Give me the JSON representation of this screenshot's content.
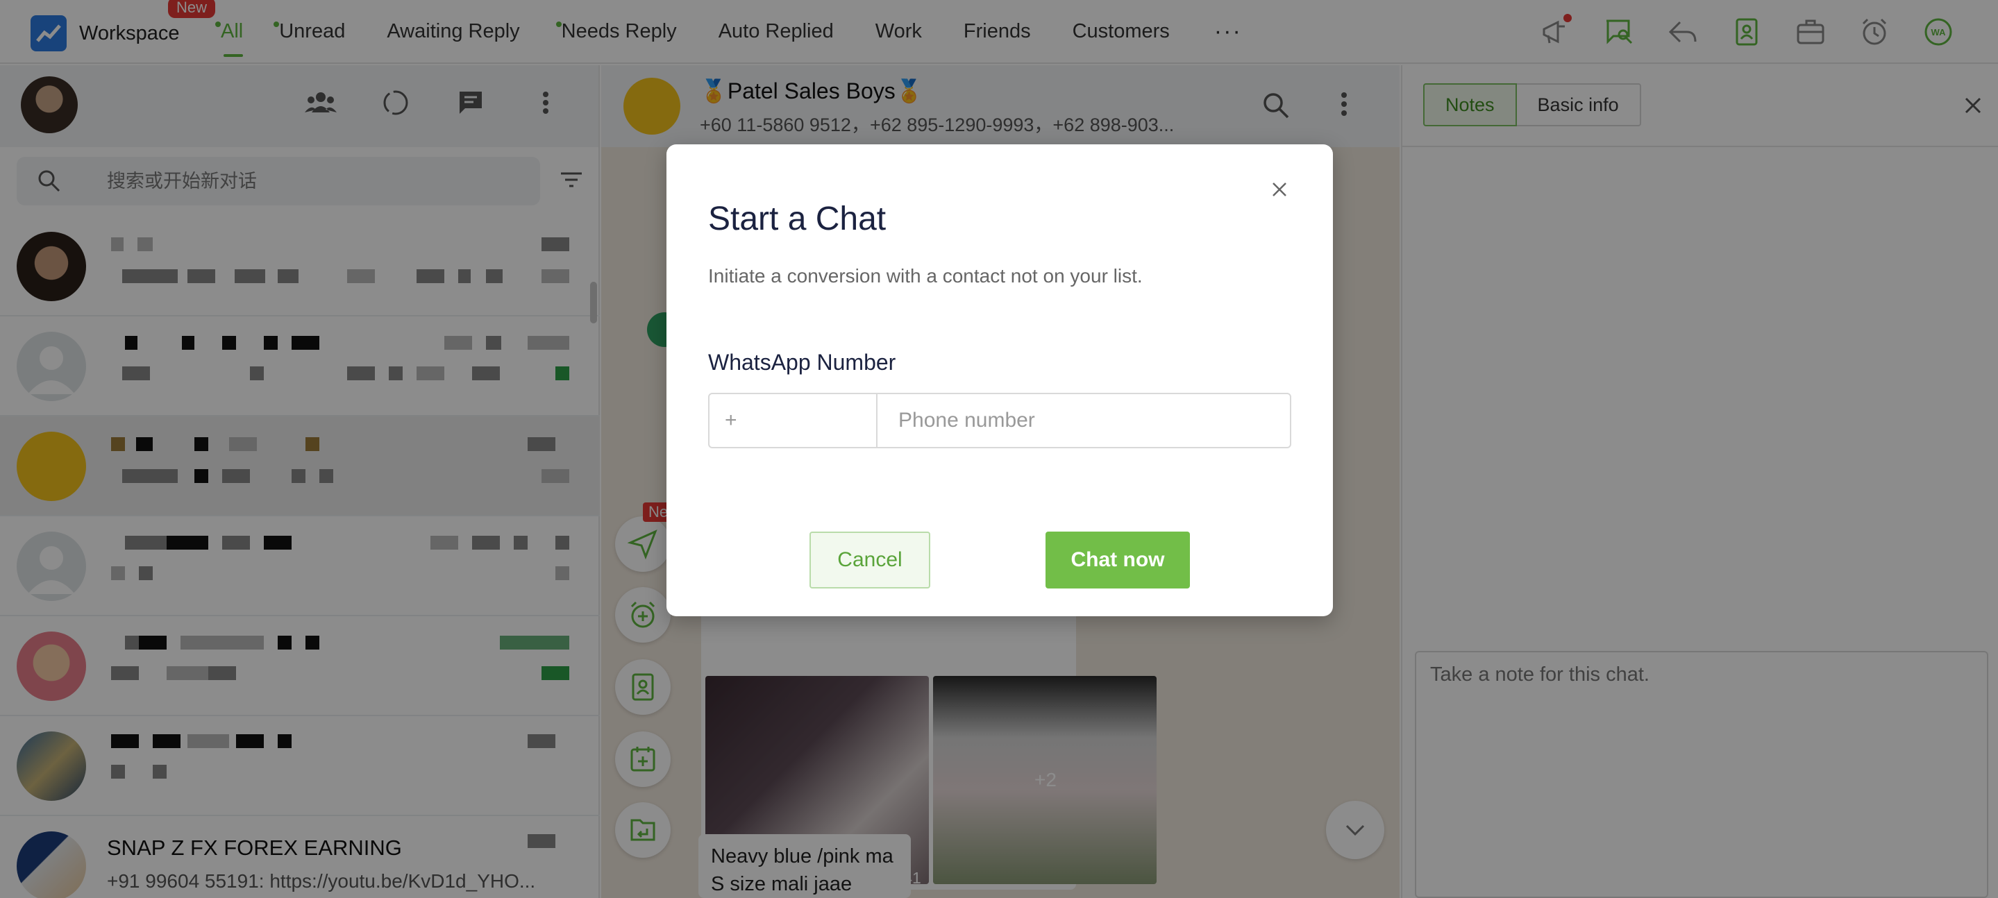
{
  "topbar": {
    "brand": "Workspace",
    "new_badge": "New",
    "tabs": [
      {
        "label": "All",
        "dot": true,
        "active": true
      },
      {
        "label": "Unread",
        "dot": true
      },
      {
        "label": "Awaiting Reply"
      },
      {
        "label": "Needs Reply",
        "dot": true
      },
      {
        "label": "Auto Replied"
      },
      {
        "label": "Work"
      },
      {
        "label": "Friends"
      },
      {
        "label": "Customers"
      }
    ],
    "more": "···",
    "icons": [
      "megaphone-icon",
      "chat-search-icon",
      "reply-icon",
      "contacts-icon",
      "toolbox-icon",
      "alarm-icon",
      "wa-logo-icon"
    ],
    "colors": {
      "accent": "#5fb640",
      "badge": "#e53935"
    }
  },
  "left": {
    "search_placeholder": "搜索或开始新对话",
    "chats": [
      {
        "name": "",
        "preview": ""
      },
      {
        "name": "",
        "preview": ""
      },
      {
        "name": "",
        "preview": ""
      },
      {
        "name": "",
        "preview": ""
      },
      {
        "name": "",
        "preview": ""
      },
      {
        "name": "",
        "preview": ""
      },
      {
        "name": "SNAP Z FX FOREX EARNING",
        "preview": "+91 99604 55191: https://youtu.be/KvD1d_YHO..."
      }
    ]
  },
  "conversation": {
    "group_name": "🏅Patel Sales Boys🏅",
    "members": "+60 11-5860 9512，+62 895-1290-9993，+62 898-903...",
    "ne_badge": "Ne",
    "photo_time": "晚上7:41",
    "more_photos": "+2",
    "message_line1": "Neavy blue /pink ma",
    "message_line2": "S size mali jaae"
  },
  "right": {
    "tab_notes": "Notes",
    "tab_basic": "Basic info",
    "note_placeholder": "Take a note for this chat."
  },
  "modal": {
    "title": "Start a Chat",
    "description": "Initiate a conversion with a contact not on your list.",
    "field_label": "WhatsApp Number",
    "country_code_placeholder": "+",
    "phone_placeholder": "Phone number",
    "cancel": "Cancel",
    "confirm": "Chat now"
  }
}
